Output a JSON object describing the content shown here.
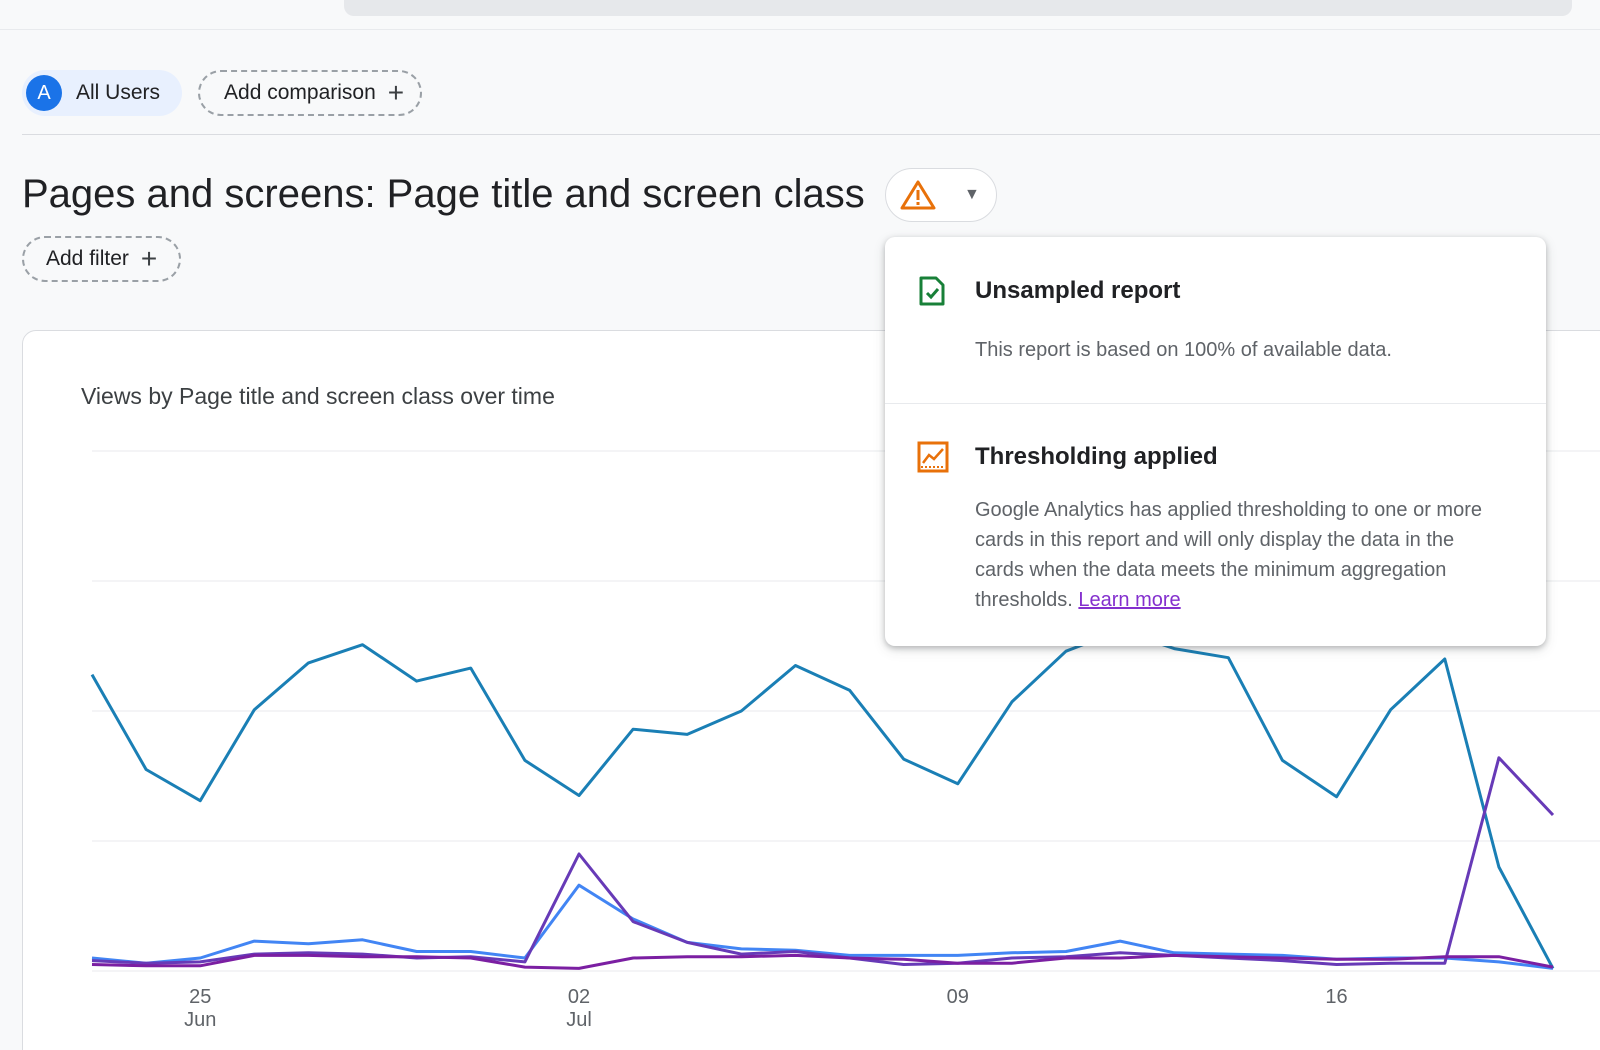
{
  "segments": {
    "all_users_avatar": "A",
    "all_users_label": "All Users",
    "add_comparison_label": "Add comparison"
  },
  "report": {
    "title": "Pages and screens: Page title and screen class",
    "add_filter_label": "Add filter",
    "warning_icon": "warning-triangle-icon"
  },
  "chart": {
    "title": "Views by Page title and screen class over time"
  },
  "popover": {
    "unsampled_heading": "Unsampled report",
    "unsampled_body": "This report is based on 100% of available data.",
    "threshold_heading": "Thresholding applied",
    "threshold_body": "Google Analytics has applied thresholding to one or more cards in this report and will only display the data in the cards when the data meets the minimum aggregation thresholds.",
    "learn_more": "Learn more"
  },
  "colors": {
    "accent": "#1a73e8",
    "warning": "#e8710a",
    "success": "#188038",
    "link": "#8430ce"
  },
  "chart_data": {
    "type": "line",
    "title": "Views by Page title and screen class over time",
    "x": [
      "Jun 23",
      "Jun 24",
      "Jun 25",
      "Jun 26",
      "Jun 27",
      "Jun 28",
      "Jun 29",
      "Jun 30",
      "Jul 01",
      "Jul 02",
      "Jul 03",
      "Jul 04",
      "Jul 05",
      "Jul 06",
      "Jul 07",
      "Jul 08",
      "Jul 09",
      "Jul 10",
      "Jul 11",
      "Jul 12",
      "Jul 13",
      "Jul 14",
      "Jul 15",
      "Jul 16",
      "Jul 17",
      "Jul 18",
      "Jul 19",
      "Jul 20"
    ],
    "x_tick_labels": [
      {
        "day": "25",
        "month": "Jun",
        "index": 2
      },
      {
        "day": "02",
        "month": "Jul",
        "index": 9
      },
      {
        "day": "09",
        "month": "",
        "index": 16
      },
      {
        "day": "16",
        "month": "",
        "index": 23
      }
    ],
    "series": [
      {
        "color": "#1a7fb5",
        "values": [
          228,
          155,
          131,
          201,
          237,
          251,
          223,
          233,
          162,
          135,
          186,
          182,
          200,
          235,
          216,
          163,
          144,
          207,
          246,
          262,
          248,
          241,
          162,
          134,
          201,
          240,
          80,
          2
        ]
      },
      {
        "color": "#4285f4",
        "values": [
          10,
          6,
          10,
          23,
          21,
          24,
          15,
          15,
          10,
          66,
          40,
          22,
          17,
          16,
          12,
          12,
          12,
          14,
          15,
          23,
          14,
          13,
          12,
          9,
          10,
          10,
          7,
          2
        ]
      },
      {
        "color": "#673ab7",
        "values": [
          8,
          6,
          7,
          13,
          14,
          13,
          10,
          11,
          7,
          90,
          38,
          22,
          13,
          15,
          10,
          5,
          6,
          10,
          11,
          14,
          12,
          10,
          8,
          5,
          6,
          6,
          164,
          120
        ]
      },
      {
        "color": "#7b1fa2",
        "values": [
          5,
          4,
          4,
          12,
          12,
          11,
          11,
          10,
          3,
          2,
          10,
          11,
          11,
          12,
          10,
          9,
          6,
          6,
          10,
          10,
          12,
          11,
          10,
          9,
          9,
          11,
          11,
          3
        ]
      }
    ],
    "ylim": [
      0,
      400
    ],
    "grid": true
  }
}
